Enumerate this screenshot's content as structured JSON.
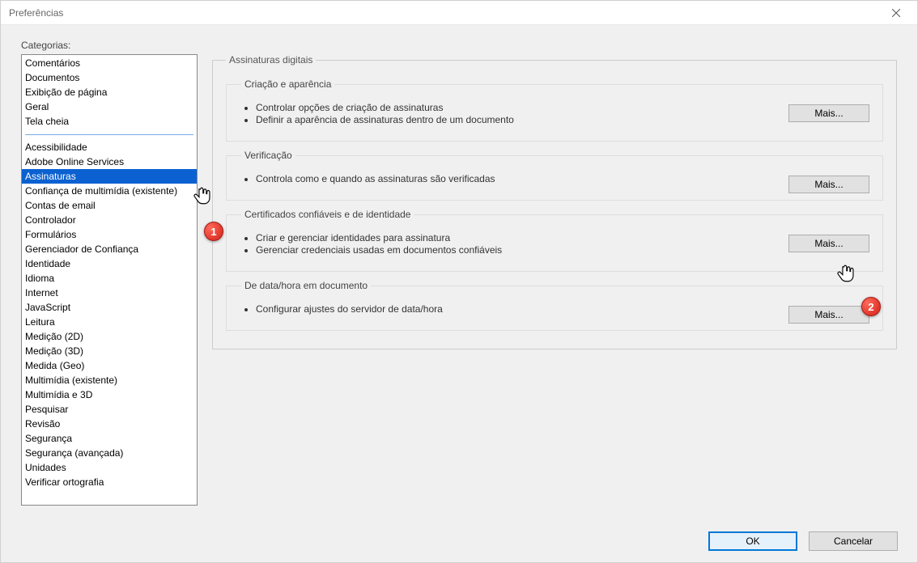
{
  "window": {
    "title": "Preferências"
  },
  "categories_label": "Categorias:",
  "categories": {
    "group1": [
      "Comentários",
      "Documentos",
      "Exibição de página",
      "Geral",
      "Tela cheia"
    ],
    "group2": [
      "Acessibilidade",
      "Adobe Online Services",
      "Assinaturas",
      "Confiança de multimídia (existente)",
      "Contas de email",
      "Controlador",
      "Formulários",
      "Gerenciador de Confiança",
      "Identidade",
      "Idioma",
      "Internet",
      "JavaScript",
      "Leitura",
      "Medição (2D)",
      "Medição (3D)",
      "Medida (Geo)",
      "Multimídia (existente)",
      "Multimídia e 3D",
      "Pesquisar",
      "Revisão",
      "Segurança",
      "Segurança (avançada)",
      "Unidades",
      "Verificar ortografia"
    ]
  },
  "selected_category": "Assinaturas",
  "panel": {
    "title": "Assinaturas digitais",
    "more_label": "Mais...",
    "sections": [
      {
        "title": "Criação e aparência",
        "bullets": [
          "Controlar opções de criação de assinaturas",
          "Definir a aparência de assinaturas dentro de um documento"
        ]
      },
      {
        "title": "Verificação",
        "bullets": [
          "Controla como e quando as assinaturas são verificadas"
        ]
      },
      {
        "title": "Certificados confiáveis e de identidade",
        "bullets": [
          "Criar e gerenciar identidades para assinatura",
          "Gerenciar credenciais usadas em documentos confiáveis"
        ]
      },
      {
        "title": "De data/hora em documento",
        "bullets": [
          "Configurar ajustes do servidor de data/hora"
        ]
      }
    ]
  },
  "buttons": {
    "ok": "OK",
    "cancel": "Cancelar"
  },
  "annotations": {
    "marker1": "1",
    "marker2": "2"
  }
}
